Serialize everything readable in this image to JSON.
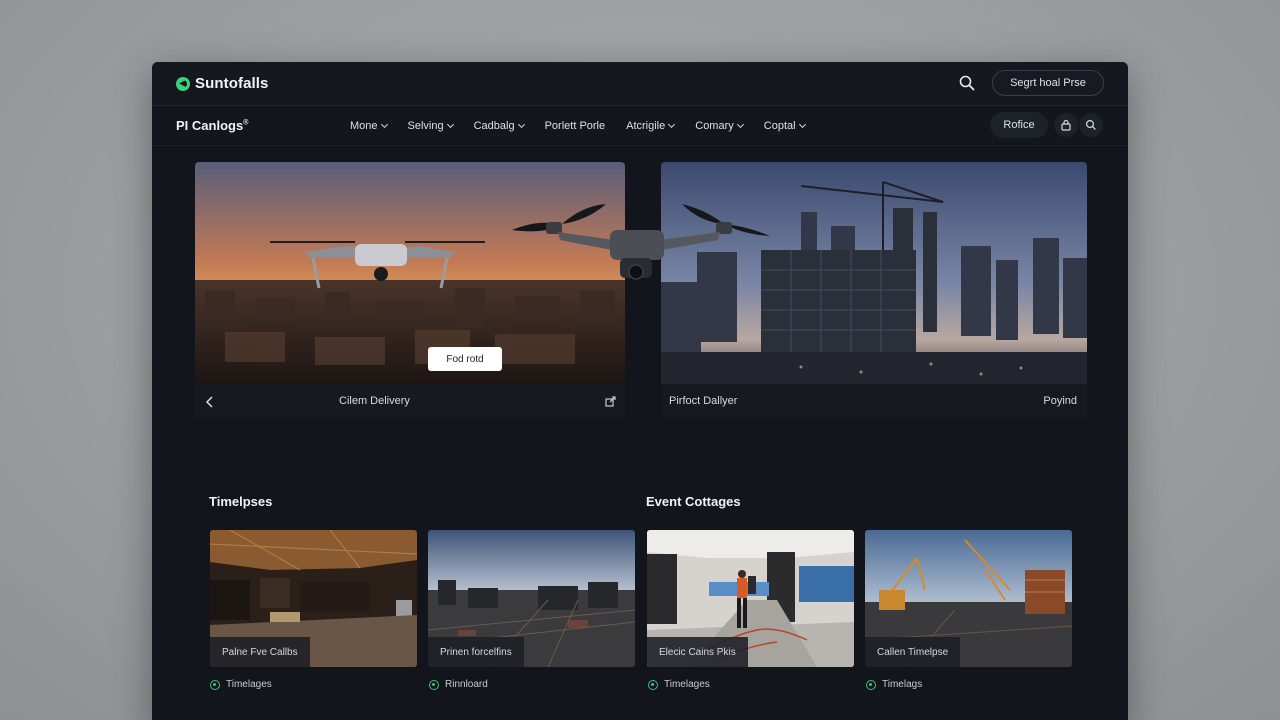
{
  "app": {
    "logo_text": "Suntofalls",
    "cta_label": "Segrt hoal Prse"
  },
  "nav": {
    "brand": "PI Canlogs",
    "brand_mark": "®",
    "items": [
      {
        "label": "Mone",
        "has_dropdown": true
      },
      {
        "label": "Selving",
        "has_dropdown": true
      },
      {
        "label": "Cadbalg",
        "has_dropdown": true
      },
      {
        "label": "Porlett Porle",
        "has_dropdown": false
      },
      {
        "label": "Atcrigile",
        "has_dropdown": true
      },
      {
        "label": "Comary",
        "has_dropdown": true
      },
      {
        "label": "Coptal",
        "has_dropdown": true
      }
    ],
    "button_label": "Rofice"
  },
  "hero": {
    "left": {
      "caption": "Cilem Delivery",
      "tag_label": "Fod rotd"
    },
    "right": {
      "caption": "Pirfoct Dallyer",
      "action_label": "Poyind"
    }
  },
  "sections": {
    "left_title": "Timelpses",
    "right_title": "Event Cottages"
  },
  "cards": [
    {
      "caption": "Palne Fve Callbs",
      "meta": "Timelages"
    },
    {
      "caption": "Prinen forcelfins",
      "meta": "Rinnloard"
    },
    {
      "caption": "Elecic Cains Pkis",
      "meta": "Timelages"
    },
    {
      "caption": "Callen Timelpse",
      "meta": "Timelags"
    }
  ],
  "colors": {
    "accent": "#3fd07a",
    "background": "#12151b"
  }
}
